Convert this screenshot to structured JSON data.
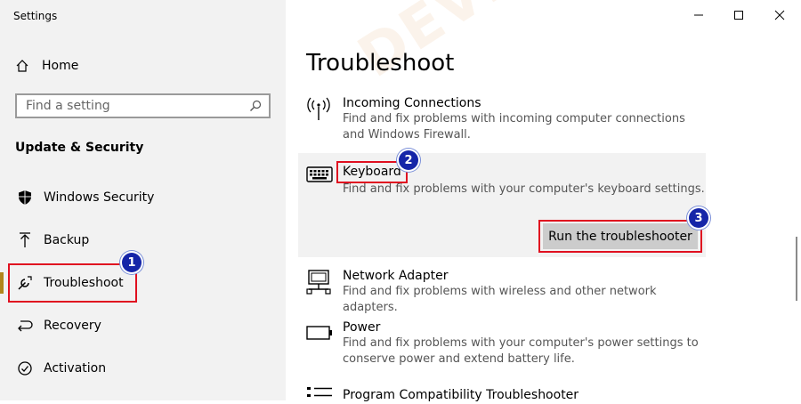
{
  "window": {
    "title": "Settings"
  },
  "sidebar": {
    "home_label": "Home",
    "search_placeholder": "Find a setting",
    "section_heading": "Update & Security",
    "items": [
      {
        "label": "Windows Security",
        "icon": "shield-icon"
      },
      {
        "label": "Backup",
        "icon": "backup-arrow-icon"
      },
      {
        "label": "Troubleshoot",
        "icon": "wrench-icon",
        "selected": true
      },
      {
        "label": "Recovery",
        "icon": "recovery-icon"
      },
      {
        "label": "Activation",
        "icon": "activation-check-icon"
      }
    ]
  },
  "main": {
    "title": "Troubleshoot",
    "items": [
      {
        "title": "Incoming Connections",
        "desc": "Find and fix problems with incoming computer connections and Windows Firewall.",
        "icon": "wireless-antenna-icon"
      },
      {
        "title": "Keyboard",
        "desc": "Find and fix problems with your computer's keyboard settings.",
        "icon": "keyboard-icon",
        "expanded": true
      },
      {
        "title": "Network Adapter",
        "desc": "Find and fix problems with wireless and other network adapters.",
        "icon": "network-adapter-icon"
      },
      {
        "title": "Power",
        "desc": "Find and fix problems with your computer's power settings to conserve power and extend battery life.",
        "icon": "battery-icon"
      },
      {
        "title": "Program Compatibility Troubleshooter",
        "desc": "",
        "icon": "list-icon"
      }
    ],
    "run_button_label": "Run the troubleshooter"
  },
  "annotations": {
    "badge1": "1",
    "badge2": "2",
    "badge3": "3"
  },
  "watermark": "DEVICETRICKS",
  "colors": {
    "highlight": "#e01020",
    "badge": "#1525a8",
    "accent": "#b1861b"
  }
}
